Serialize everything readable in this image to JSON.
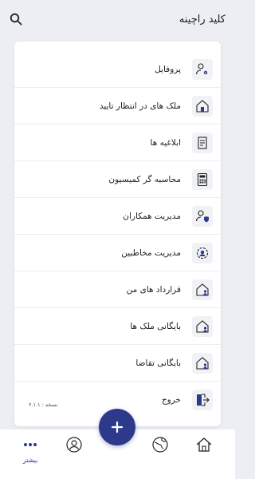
{
  "header": {
    "title": "کلید راچینه",
    "search_icon": "search-icon"
  },
  "menu": [
    {
      "label": "پروفایل",
      "icon": "user-gear-icon"
    },
    {
      "label": "ملک های در انتظار تایید",
      "icon": "house-pending-icon"
    },
    {
      "label": "ابلاغیه ها",
      "icon": "document-icon"
    },
    {
      "label": "محاسبه گر کمیسیون",
      "icon": "calculator-icon"
    },
    {
      "label": "مدیریت همکاران",
      "icon": "user-shield-icon"
    },
    {
      "label": "مدیریت مخاطبین",
      "icon": "contacts-icon"
    },
    {
      "label": "قرارداد های من",
      "icon": "house-user-icon"
    },
    {
      "label": "بایگانی ملک ها",
      "icon": "house-user-icon"
    },
    {
      "label": "بایگانی تقاضا",
      "icon": "house-user-icon"
    },
    {
      "label": "خروج",
      "icon": "logout-icon"
    }
  ],
  "version_text": "نسخه : ۲.۱.۱",
  "fab": {
    "icon": "plus-icon"
  },
  "bottom_nav": [
    {
      "label": "بیشتر",
      "icon": "more-dots-icon",
      "active": true
    },
    {
      "label": "",
      "icon": "user-icon",
      "active": false
    },
    {
      "label": "",
      "icon": "globe-icon",
      "active": false
    },
    {
      "label": "",
      "icon": "home-icon",
      "active": false
    }
  ],
  "colors": {
    "accent": "#2d3a8c",
    "background": "#eceef4",
    "card": "#ffffff"
  }
}
